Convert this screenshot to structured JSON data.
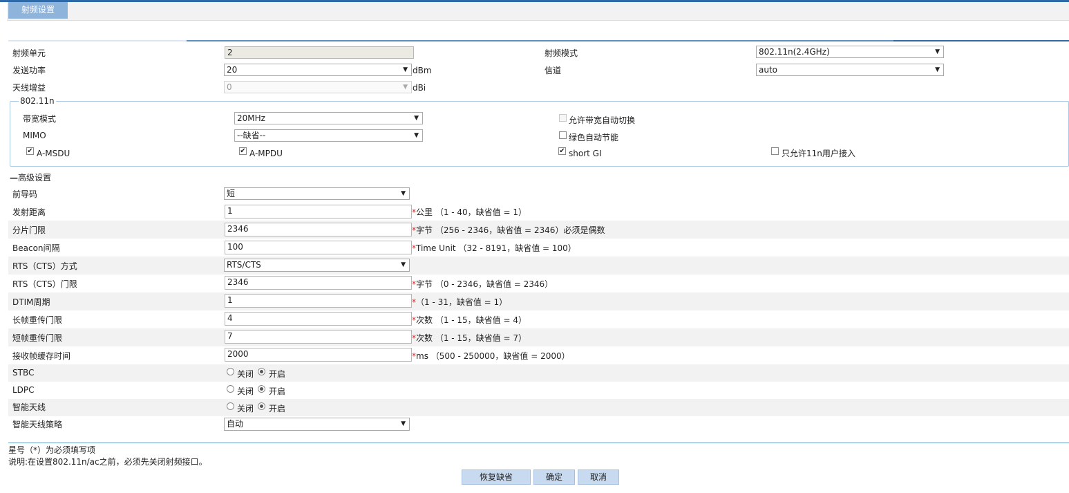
{
  "tab": {
    "label": "射频设置"
  },
  "basic": {
    "radio_unit": {
      "label": "射频单元",
      "value": "2"
    },
    "radio_mode": {
      "label": "射频模式",
      "value": "802.11n(2.4GHz)"
    },
    "tx_power": {
      "label": "发送功率",
      "value": "20",
      "unit": "dBm"
    },
    "channel": {
      "label": "信道",
      "value": "auto"
    },
    "antenna_gain": {
      "label": "天线增益",
      "value": "0",
      "unit": "dBi"
    }
  },
  "n11": {
    "legend": "802.11n",
    "bandwidth": {
      "label": "带宽模式",
      "value": "20MHz"
    },
    "auto_bw_switch": {
      "label": "允许带宽自动切换",
      "checked": false,
      "disabled": true
    },
    "mimo": {
      "label": "MIMO",
      "value": "--缺省--"
    },
    "green_power": {
      "label": "绿色自动节能",
      "checked": false
    },
    "amsdu": {
      "label": "A-MSDU",
      "checked": true
    },
    "ampdu": {
      "label": "A-MPDU",
      "checked": true
    },
    "short_gi": {
      "label": "short GI",
      "checked": true
    },
    "only_11n": {
      "label": "只允许11n用户接入",
      "checked": false
    }
  },
  "advanced": {
    "title": "高级设置",
    "toggle_symbol": "—",
    "preamble": {
      "label": "前导码",
      "value": "短"
    },
    "distance": {
      "label": "发射距离",
      "value": "1",
      "hint": "公里  （1 - 40，缺省值 = 1）"
    },
    "frag": {
      "label": "分片门限",
      "value": "2346",
      "hint": "字节  （256 - 2346，缺省值 = 2346）必须是偶数"
    },
    "beacon": {
      "label": "Beacon间隔",
      "value": "100",
      "hint": "Time Unit  （32 - 8191，缺省值 = 100）"
    },
    "rts_mode": {
      "label": "RTS（CTS）方式",
      "value": "RTS/CTS"
    },
    "rts_threshold": {
      "label": "RTS（CTS）门限",
      "value": "2346",
      "hint": "字节  （0 - 2346，缺省值 = 2346）"
    },
    "dtim": {
      "label": "DTIM周期",
      "value": "1",
      "hint": "（1 - 31，缺省值 = 1）"
    },
    "long_retry": {
      "label": "长帧重传门限",
      "value": "4",
      "hint": "次数  （1 - 15，缺省值 = 4）"
    },
    "short_retry": {
      "label": "短帧重传门限",
      "value": "7",
      "hint": "次数  （1 - 15，缺省值 = 7）"
    },
    "rx_buffer": {
      "label": "接收帧缓存时间",
      "value": "2000",
      "hint": "ms  （500 - 250000，缺省值 = 2000）"
    },
    "stbc": {
      "label": "STBC",
      "off": "关闭",
      "on": "开启",
      "selected": "on"
    },
    "ldpc": {
      "label": "LDPC",
      "off": "关闭",
      "on": "开启",
      "selected": "on"
    },
    "smart_ant": {
      "label": "智能天线",
      "off": "关闭",
      "on": "开启",
      "selected": "on"
    },
    "smart_ant_policy": {
      "label": "智能天线策略",
      "value": "自动"
    }
  },
  "required_marker": "*",
  "footer": {
    "note1": "星号（*）为必须填写项",
    "note2": "说明:在设置802.11n/ac之前，必须先关闭射频接口。",
    "restore_label": "恢复缺省",
    "ok_label": "确定",
    "cancel_label": "取消"
  },
  "colors": {
    "accent": "#2e69a8",
    "tab_bg": "#8fb4dc",
    "button_bg": "#c8daf0",
    "required": "#e02020"
  }
}
